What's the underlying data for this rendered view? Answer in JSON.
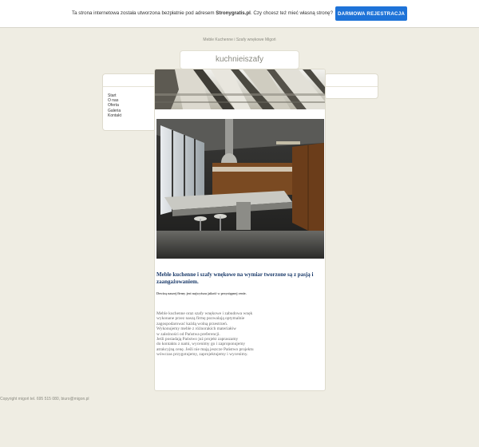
{
  "promo": {
    "message_prefix": "Ta strona internetowa została utworzona bezpłatnie pod adresem ",
    "site_name": "Stronygratis.pl",
    "message_suffix": ". Czy chcesz też mieć własną stronę?",
    "cta_label": "DARMOWA REJESTRACJA",
    "cta_color": "#1e73d8"
  },
  "site": {
    "tagline": "Meble Kuchenne i Szafy wnękowe Migoń",
    "title": "kuchnieiszafy"
  },
  "nav": {
    "items": [
      {
        "label": "Start"
      },
      {
        "label": "O nas"
      },
      {
        "label": "Oferta"
      },
      {
        "label": "Galeria"
      },
      {
        "label": "Kontakt"
      }
    ]
  },
  "content": {
    "headline": "Meble kuchenne i szafy wnękowe na wymiar tworzone są z pasją i zaangażowaniem.",
    "subline": "Dewizą naszej  firmy jest najwyższa jakość w przystępnej cenie.",
    "paragraph_lines": [
      "Meble kuchenne oraz szafy wnękowe i zabudowa wnęk",
      "wykonane przez naszą firmę pozwalają optymalnie",
      "zagospodarować każdą wolną przestrzeń.",
      "Wykonujemy meble z różnorakich materiałów",
      "w zależności od Państwa preferencji.",
      "Jeśli posiadają Państwo już projekt zapraszamy",
      "do kontaktu z nami, wycenimy go i zaproponujemy",
      "atrakcyjną cenę. Jeśli nie mają jeszcze Państwo projektu",
      "wówczas przygotujemy, zaprojektujemy i wycenimy."
    ]
  },
  "footer": {
    "text": "Copyright migoń tel. 695 515 080, biuro@migon.pl"
  }
}
